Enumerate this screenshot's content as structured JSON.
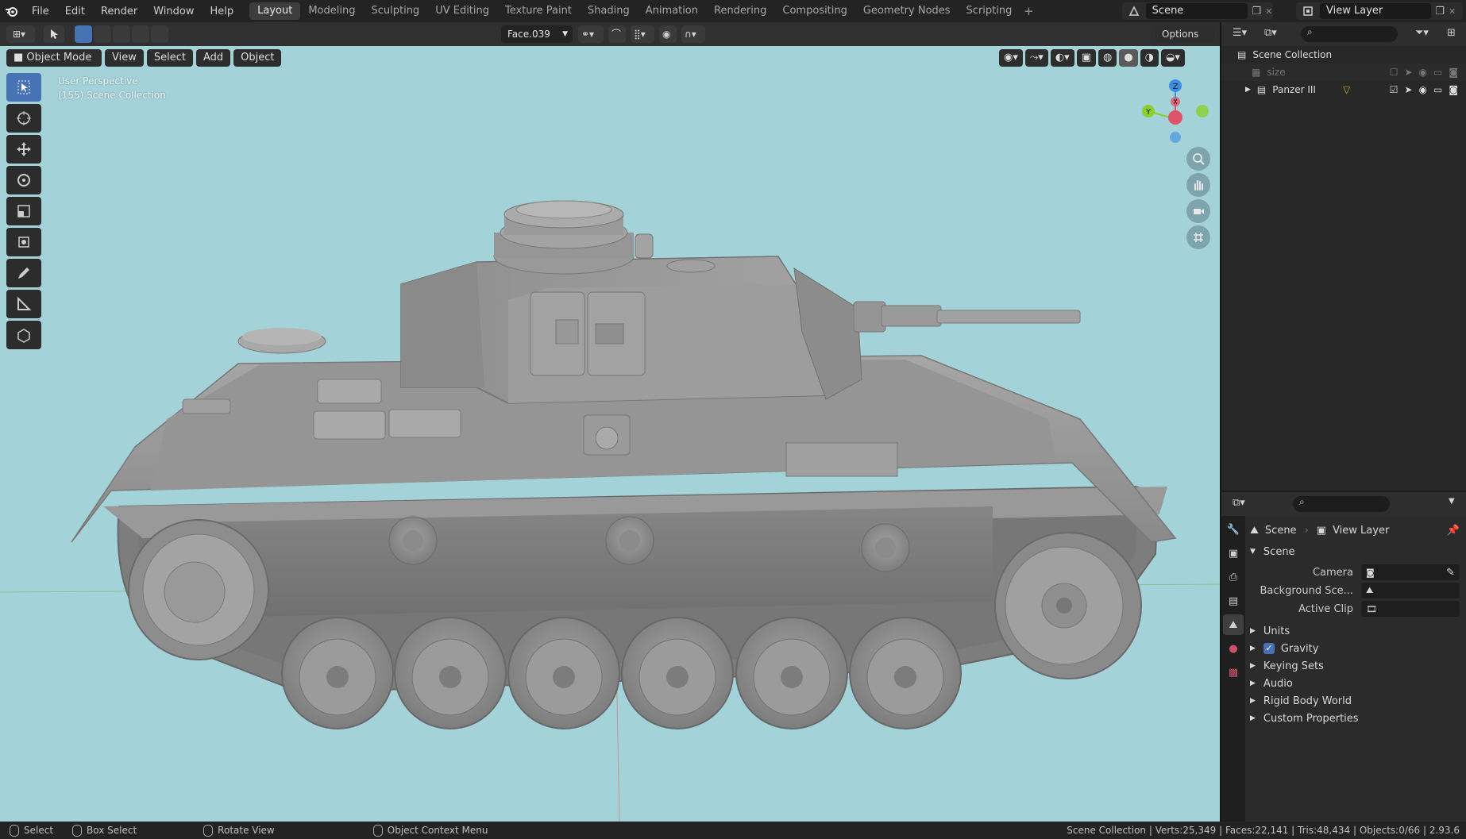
{
  "topbar": {
    "menus": [
      "File",
      "Edit",
      "Render",
      "Window",
      "Help"
    ],
    "workspaces": [
      "Layout",
      "Modeling",
      "Sculpting",
      "UV Editing",
      "Texture Paint",
      "Shading",
      "Animation",
      "Rendering",
      "Compositing",
      "Geometry Nodes",
      "Scripting"
    ],
    "active_workspace": "Layout",
    "scene_name": "Scene",
    "view_layer_name": "View Layer"
  },
  "tool_header": {
    "transform_orientation": "Face.039",
    "options_label": "Options"
  },
  "viewport": {
    "mode_label": "Object Mode",
    "menus": [
      "View",
      "Select",
      "Add",
      "Object"
    ],
    "perspective_label": "User Perspective",
    "collection_label": "(155) Scene Collection",
    "gizmo_axes": {
      "z": "Z",
      "y": "Y",
      "x": "X"
    },
    "background_color": "#a4d2d9",
    "model_color": "#8e8e8e"
  },
  "outliner": {
    "root": "Scene Collection",
    "items": [
      {
        "name": "size",
        "dimmed": true
      },
      {
        "name": "Panzer III",
        "dimmed": false
      }
    ]
  },
  "properties": {
    "breadcrumb_scene": "Scene",
    "breadcrumb_view_layer": "View Layer",
    "panel_title": "Scene",
    "fields": [
      {
        "label": "Camera",
        "value": ""
      },
      {
        "label": "Background Sce...",
        "value": ""
      },
      {
        "label": "Active Clip",
        "value": ""
      }
    ],
    "subpanels": [
      {
        "label": "Units",
        "has_checkbox": false
      },
      {
        "label": "Gravity",
        "has_checkbox": true,
        "checked": true
      },
      {
        "label": "Keying Sets",
        "has_checkbox": false
      },
      {
        "label": "Audio",
        "has_checkbox": false
      },
      {
        "label": "Rigid Body World",
        "has_checkbox": false
      },
      {
        "label": "Custom Properties",
        "has_checkbox": false
      }
    ]
  },
  "statusbar": {
    "select": "Select",
    "box_select": "Box Select",
    "rotate_view": "Rotate View",
    "context_menu": "Object Context Menu",
    "stats": "Scene Collection | Verts:25,349 | Faces:22,141 | Tris:48,434 | Objects:0/66 | 2.93.6"
  },
  "colors": {
    "accent": "#4772b3",
    "axis_x": "#e0546a",
    "axis_y": "#8bcf2c",
    "axis_z": "#3b8ee0"
  }
}
